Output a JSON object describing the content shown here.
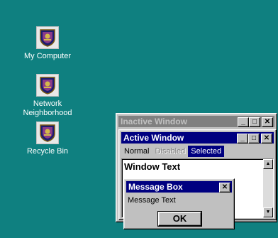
{
  "desktop": {
    "background_color": "#0f8080",
    "icons": [
      {
        "label": "My Computer",
        "icon": "shield-crest-icon"
      },
      {
        "label": "Network Neighborhood",
        "icon": "shield-crest-icon"
      },
      {
        "label": "Recycle Bin",
        "icon": "shield-crest-icon"
      }
    ]
  },
  "inactive_window": {
    "title": "Inactive Window",
    "title_color": "#808080",
    "buttons": [
      "_",
      "□",
      "✕"
    ]
  },
  "active_window": {
    "title": "Active Window",
    "title_color": "#000080",
    "buttons": [
      "_",
      "□",
      "✕"
    ],
    "menu": {
      "normal": "Normal",
      "disabled": "Disabled",
      "selected": "Selected"
    },
    "window_text": "Window Text",
    "scroll_arrows": {
      "up": "▲",
      "down": "▼"
    }
  },
  "message_box": {
    "title": "Message Box",
    "close": "✕",
    "message": "Message Text",
    "ok_label": "OK"
  }
}
